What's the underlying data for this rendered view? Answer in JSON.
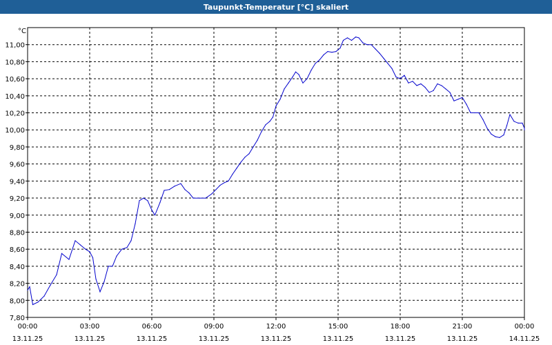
{
  "window": {
    "title": "Taupunkt-Temperatur [°C] skaliert"
  },
  "colors": {
    "title_bar": "#1f5f97",
    "series_line": "#0000cc",
    "grid": "#000000",
    "background": "#ffffff"
  },
  "chart_data": {
    "type": "line",
    "title": "Taupunkt-Temperatur [°C] skaliert",
    "ylabel": "°C",
    "xlabel": "",
    "ylim": [
      7.8,
      11.2
    ],
    "xlim_hours": [
      0,
      24
    ],
    "grid": true,
    "y_ticks": [
      "7,80",
      "8,00",
      "8,20",
      "8,40",
      "8,60",
      "8,80",
      "9,00",
      "9,20",
      "9,40",
      "9,60",
      "9,80",
      "10,00",
      "10,20",
      "10,40",
      "10,60",
      "10,80",
      "11,00"
    ],
    "x_ticks": [
      {
        "time": "00:00",
        "date": "13.11.25"
      },
      {
        "time": "03:00",
        "date": "13.11.25"
      },
      {
        "time": "06:00",
        "date": "13.11.25"
      },
      {
        "time": "09:00",
        "date": "13.11.25"
      },
      {
        "time": "12:00",
        "date": "13.11.25"
      },
      {
        "time": "15:00",
        "date": "13.11.25"
      },
      {
        "time": "18:00",
        "date": "13.11.25"
      },
      {
        "time": "21:00",
        "date": "13.11.25"
      },
      {
        "time": "00:00",
        "date": "14.11.25"
      }
    ],
    "series": [
      {
        "points": [
          [
            0.0,
            8.12
          ],
          [
            0.1,
            8.16
          ],
          [
            0.25,
            7.95
          ],
          [
            0.5,
            7.98
          ],
          [
            0.8,
            8.05
          ],
          [
            1.1,
            8.18
          ],
          [
            1.4,
            8.3
          ],
          [
            1.65,
            8.55
          ],
          [
            2.0,
            8.48
          ],
          [
            2.3,
            8.7
          ],
          [
            2.55,
            8.65
          ],
          [
            2.8,
            8.6
          ],
          [
            3.0,
            8.57
          ],
          [
            3.15,
            8.5
          ],
          [
            3.3,
            8.25
          ],
          [
            3.5,
            8.1
          ],
          [
            3.7,
            8.22
          ],
          [
            3.9,
            8.4
          ],
          [
            4.1,
            8.4
          ],
          [
            4.3,
            8.52
          ],
          [
            4.55,
            8.6
          ],
          [
            4.8,
            8.62
          ],
          [
            5.0,
            8.7
          ],
          [
            5.2,
            8.9
          ],
          [
            5.4,
            9.17
          ],
          [
            5.6,
            9.2
          ],
          [
            5.8,
            9.17
          ],
          [
            6.0,
            9.06
          ],
          [
            6.15,
            9.0
          ],
          [
            6.4,
            9.15
          ],
          [
            6.6,
            9.29
          ],
          [
            6.85,
            9.3
          ],
          [
            7.1,
            9.34
          ],
          [
            7.4,
            9.37
          ],
          [
            7.6,
            9.3
          ],
          [
            7.8,
            9.26
          ],
          [
            8.0,
            9.2
          ],
          [
            8.3,
            9.2
          ],
          [
            8.6,
            9.2
          ],
          [
            8.9,
            9.25
          ],
          [
            9.1,
            9.3
          ],
          [
            9.3,
            9.35
          ],
          [
            9.5,
            9.38
          ],
          [
            9.7,
            9.4
          ],
          [
            9.9,
            9.48
          ],
          [
            10.1,
            9.55
          ],
          [
            10.3,
            9.62
          ],
          [
            10.5,
            9.68
          ],
          [
            10.7,
            9.72
          ],
          [
            10.9,
            9.8
          ],
          [
            11.1,
            9.88
          ],
          [
            11.3,
            9.98
          ],
          [
            11.5,
            10.06
          ],
          [
            11.7,
            10.1
          ],
          [
            11.85,
            10.15
          ],
          [
            12.0,
            10.28
          ],
          [
            12.2,
            10.36
          ],
          [
            12.4,
            10.48
          ],
          [
            12.6,
            10.55
          ],
          [
            12.8,
            10.62
          ],
          [
            12.95,
            10.68
          ],
          [
            13.1,
            10.65
          ],
          [
            13.3,
            10.55
          ],
          [
            13.5,
            10.6
          ],
          [
            13.7,
            10.7
          ],
          [
            13.9,
            10.78
          ],
          [
            14.1,
            10.82
          ],
          [
            14.3,
            10.88
          ],
          [
            14.5,
            10.92
          ],
          [
            14.7,
            10.91
          ],
          [
            14.9,
            10.92
          ],
          [
            15.1,
            10.96
          ],
          [
            15.25,
            11.05
          ],
          [
            15.45,
            11.08
          ],
          [
            15.65,
            11.05
          ],
          [
            15.85,
            11.09
          ],
          [
            16.0,
            11.08
          ],
          [
            16.2,
            11.02
          ],
          [
            16.4,
            11.0
          ],
          [
            16.6,
            11.0
          ],
          [
            16.8,
            10.95
          ],
          [
            17.0,
            10.9
          ],
          [
            17.2,
            10.84
          ],
          [
            17.4,
            10.78
          ],
          [
            17.6,
            10.72
          ],
          [
            17.8,
            10.62
          ],
          [
            18.0,
            10.6
          ],
          [
            18.2,
            10.64
          ],
          [
            18.4,
            10.55
          ],
          [
            18.6,
            10.57
          ],
          [
            18.8,
            10.52
          ],
          [
            19.0,
            10.54
          ],
          [
            19.2,
            10.5
          ],
          [
            19.4,
            10.44
          ],
          [
            19.6,
            10.46
          ],
          [
            19.8,
            10.54
          ],
          [
            20.0,
            10.52
          ],
          [
            20.2,
            10.48
          ],
          [
            20.4,
            10.44
          ],
          [
            20.6,
            10.34
          ],
          [
            20.8,
            10.36
          ],
          [
            21.0,
            10.38
          ],
          [
            21.2,
            10.3
          ],
          [
            21.4,
            10.2
          ],
          [
            21.6,
            10.2
          ],
          [
            21.8,
            10.2
          ],
          [
            22.0,
            10.12
          ],
          [
            22.2,
            10.02
          ],
          [
            22.4,
            9.95
          ],
          [
            22.6,
            9.92
          ],
          [
            22.8,
            9.91
          ],
          [
            23.0,
            9.94
          ],
          [
            23.15,
            10.05
          ],
          [
            23.3,
            10.18
          ],
          [
            23.5,
            10.1
          ],
          [
            23.7,
            10.08
          ],
          [
            23.9,
            10.08
          ],
          [
            24.0,
            10.02
          ],
          [
            24.15,
            10.0
          ],
          [
            24.3,
            10.01
          ]
        ]
      }
    ]
  }
}
